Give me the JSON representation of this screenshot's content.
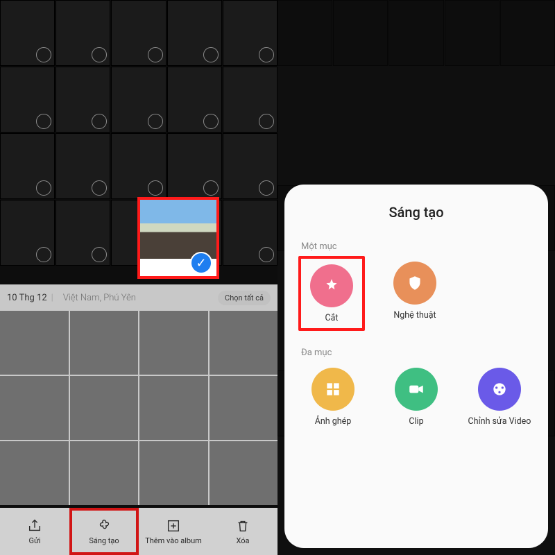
{
  "left": {
    "date": "10 Thg 12",
    "location": "Việt Nam, Phú Yên",
    "select_all": "Chọn tất cả",
    "toolbar": {
      "send": "Gửi",
      "create": "Sáng tạo",
      "add_album": "Thêm vào album",
      "delete": "Xóa"
    }
  },
  "right": {
    "title": "Sáng tạo",
    "section_single": "Một mục",
    "section_multi": "Đa mục",
    "options": {
      "cut": "Cắt",
      "art": "Nghệ thuật",
      "collage": "Ảnh ghép",
      "clip": "Clip",
      "video_edit": "Chỉnh sửa Video"
    }
  }
}
